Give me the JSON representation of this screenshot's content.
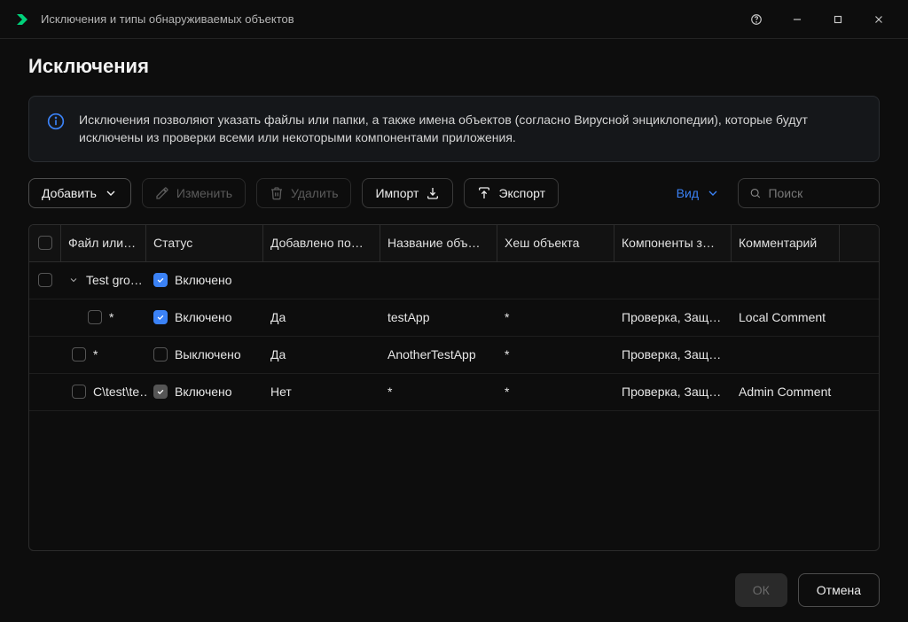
{
  "window": {
    "title": "Исключения и типы обнаруживаемых объектов"
  },
  "page": {
    "title": "Исключения",
    "info": "Исключения позволяют указать файлы или папки, а также имена объектов (согласно Вирусной энциклопедии), которые будут исключены из проверки всеми или некоторыми компонентами приложения."
  },
  "toolbar": {
    "add": "Добавить",
    "edit": "Изменить",
    "delete": "Удалить",
    "import": "Импорт",
    "export": "Экспорт",
    "view": "Вид",
    "search_placeholder": "Поиск"
  },
  "columns": {
    "file": "Файл или…",
    "status": "Статус",
    "added": "Добавлено по…",
    "name": "Название объ…",
    "hash": "Хеш объекта",
    "components": "Компоненты з…",
    "comment": "Комментарий"
  },
  "rows": [
    {
      "group": true,
      "file": "Test gro…",
      "status_on": true,
      "status_label": "Включено"
    },
    {
      "indent": true,
      "file": "*",
      "status_on": true,
      "status_label": "Включено",
      "added": "Да",
      "name": "testApp",
      "hash": "*",
      "components": "Проверка, Защи…",
      "comment": "Local Comment"
    },
    {
      "indent": false,
      "file": "*",
      "status_on": false,
      "status_label": "Выключено",
      "added": "Да",
      "name": "AnotherTestApp",
      "hash": "*",
      "components": "Проверка, Защи…",
      "comment": ""
    },
    {
      "indent": false,
      "file": "C\\test\\te…",
      "status_on": true,
      "status_locked": true,
      "status_label": "Включено",
      "added": "Нет",
      "name": "*",
      "hash": "*",
      "components": "Проверка, Защи…",
      "comment": "Admin Comment"
    }
  ],
  "footer": {
    "ok": "ОК",
    "cancel": "Отмена"
  }
}
